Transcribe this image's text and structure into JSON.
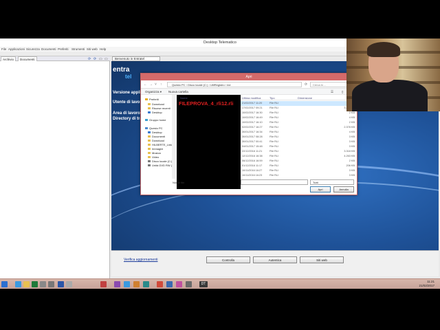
{
  "app": {
    "title": "Desktop Telematico",
    "menu": [
      "File",
      "Applicazioni",
      "Sicurezza",
      "Documenti",
      "Preferiti",
      "Strumenti",
      "Siti web",
      "Help"
    ],
    "left_tabs": [
      "Archivio",
      "Documenti"
    ],
    "main_tab": "Benvenuto in Entratel",
    "logo_main": "entra",
    "logo_sub": "tel",
    "info": {
      "version": "Versione applica",
      "user": "Utente di lavoro",
      "area": "Area di lavoro: C",
      "directory": "Directory di trasf"
    },
    "bottom": {
      "link": "Verifica aggiornamenti",
      "buttons": [
        "Controlla",
        "Autentica",
        "Siti web"
      ]
    }
  },
  "dialog": {
    "title": "Apri",
    "close": "✕",
    "breadcrumb": "Questo PC  ›  Disco locale (C:)  ›  UtilRegistro  ›  ine",
    "search_placeholder": "Cerca in ...",
    "commands": {
      "organize": "Organizza ▾",
      "new_folder": "Nuova cartella"
    },
    "nav": [
      {
        "label": "Preferiti",
        "icon": "star-icon",
        "color": "#e8b020"
      },
      {
        "label": "Download",
        "icon": "folder-icon",
        "color": "#e8c050"
      },
      {
        "label": "Risorse recenti",
        "icon": "folder-icon",
        "color": "#e8c050"
      },
      {
        "label": "Desktop",
        "icon": "desktop-icon",
        "color": "#3a7ad0"
      },
      {
        "label": "Gruppo home",
        "icon": "homegroup-icon",
        "color": "#3aa0d0"
      },
      {
        "label": "Questo PC",
        "icon": "pc-icon",
        "color": "#4a8ad0"
      },
      {
        "label": "Desktop",
        "icon": "desktop-icon",
        "color": "#3a7ad0"
      },
      {
        "label": "Documenti",
        "icon": "folder-icon",
        "color": "#e8c050"
      },
      {
        "label": "Download",
        "icon": "folder-icon",
        "color": "#e8c050"
      },
      {
        "label": "HILBERTE_Linkdin",
        "icon": "folder-icon",
        "color": "#e8c050"
      },
      {
        "label": "Immagini",
        "icon": "folder-icon",
        "color": "#e8c050"
      },
      {
        "label": "Musica",
        "icon": "folder-icon",
        "color": "#e8c050"
      },
      {
        "label": "Video",
        "icon": "folder-icon",
        "color": "#e8c050"
      },
      {
        "label": "Disco locale (C:)",
        "icon": "drive-icon",
        "color": "#7a7a7a"
      },
      {
        "label": "Unità DVD RW (",
        "icon": "drive-icon",
        "color": "#7a7a7a"
      }
    ],
    "preview_filename": "FILEPROVA_4_rli12.rli",
    "columns": [
      "Nome",
      "Ultima modifica",
      "Tipo",
      "Dimensione"
    ],
    "files": [
      {
        "date": "21/02/2017 11:20",
        "type": "File RLI",
        "size": "3 KB",
        "selected": true
      },
      {
        "date": "17/02/2017 09:21",
        "type": "File RLI",
        "size": "3.466 KB",
        "selected": false
      },
      {
        "date": "10/02/2017 16:30",
        "type": "File RLI",
        "size": "2 KB",
        "selected": false
      },
      {
        "date": "10/02/2017 16:49",
        "type": "File RLI",
        "size": "4 KB",
        "selected": false
      },
      {
        "date": "10/02/2017 16:10",
        "type": "File RLI",
        "size": "2 KB",
        "selected": false
      },
      {
        "date": "02/02/2017 16:27",
        "type": "File RLI",
        "size": "2.378 KB",
        "selected": false
      },
      {
        "date": "30/01/2017 16:34",
        "type": "File RLI",
        "size": "4 KB",
        "selected": false
      },
      {
        "date": "30/01/2017 08:28",
        "type": "File RLI",
        "size": "3 KB",
        "selected": false
      },
      {
        "date": "30/01/2017 00:41",
        "type": "File RLI",
        "size": "3 KB",
        "selected": false
      },
      {
        "date": "04/01/2017 15:48",
        "type": "File RLI",
        "size": "3 KB",
        "selected": false
      },
      {
        "date": "22/12/2016 11:21",
        "type": "File RLI",
        "size": "3.318 KB",
        "selected": false
      },
      {
        "date": "12/12/2016 16:38",
        "type": "File RLI",
        "size": "4.263 KB",
        "selected": false
      },
      {
        "date": "06/12/2016 16:59",
        "type": "File RLI",
        "size": "2 KB",
        "selected": false
      },
      {
        "date": "01/12/2016 11:17",
        "type": "File RLI",
        "size": "206 KB",
        "selected": false
      },
      {
        "date": "10/11/2016 16:27",
        "type": "File RLI",
        "size": "3 KB",
        "selected": false
      },
      {
        "date": "10/11/2016 16:23",
        "type": "File RLI",
        "size": "3 KB",
        "selected": false
      }
    ],
    "filename_label": "Nome file:",
    "filetype": "Tutti",
    "open": "Apri",
    "cancel": "Annulla"
  },
  "taskbar": {
    "icons": [
      {
        "name": "start-icon",
        "color": "#2c6fd0"
      },
      {
        "name": "ie-icon",
        "color": "#3a9ae0"
      },
      {
        "name": "explorer-icon",
        "color": "#e8c050"
      },
      {
        "name": "excel-icon",
        "color": "#1f7a3a"
      },
      {
        "name": "app-icon",
        "color": "#888888"
      },
      {
        "name": "app2-icon",
        "color": "#777777"
      },
      {
        "name": "word-icon",
        "color": "#2a56a8"
      },
      {
        "name": "app3-icon",
        "color": "#aaaaaa"
      },
      {
        "name": "app4-icon",
        "color": "#c04040"
      },
      {
        "name": "app5-icon",
        "color": "#8a4ab0"
      },
      {
        "name": "ie2-icon",
        "color": "#3a9ae0"
      },
      {
        "name": "app6-icon",
        "color": "#d08030"
      },
      {
        "name": "app7-icon",
        "color": "#2a8a8a"
      },
      {
        "name": "chrome-icon",
        "color": "#d04a3a"
      },
      {
        "name": "app8-icon",
        "color": "#3a6ab0"
      },
      {
        "name": "paint-icon",
        "color": "#c050a0"
      },
      {
        "name": "app9-icon",
        "color": "#6a6a6a"
      },
      {
        "name": "dt-icon",
        "color": "#3a3a3a"
      }
    ],
    "dt_label": "DT",
    "time": "11:21",
    "date": "21/02/2017"
  }
}
